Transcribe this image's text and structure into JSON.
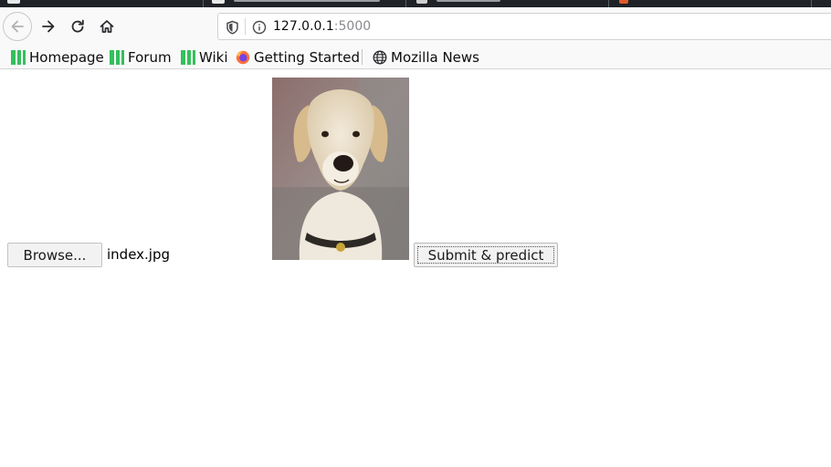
{
  "browser": {
    "url_host": "127.0.0.1",
    "url_port": ":5000",
    "bookmarks": [
      {
        "label": "Homepage",
        "icon": "manjaro-icon"
      },
      {
        "label": "Forum",
        "icon": "manjaro-icon"
      },
      {
        "label": "Wiki",
        "icon": "manjaro-icon"
      },
      {
        "label": "Getting Started",
        "icon": "firefox-icon"
      },
      {
        "label": "Mozilla News",
        "icon": "globe-icon"
      }
    ]
  },
  "form": {
    "browse_label": "Browse...",
    "selected_file": "index.jpg",
    "submit_label": "Submit & predict"
  },
  "colors": {
    "manjaro_green": "#35bf5c",
    "tabstrip": "#1f2226",
    "toolbar": "#f9f9fa"
  }
}
